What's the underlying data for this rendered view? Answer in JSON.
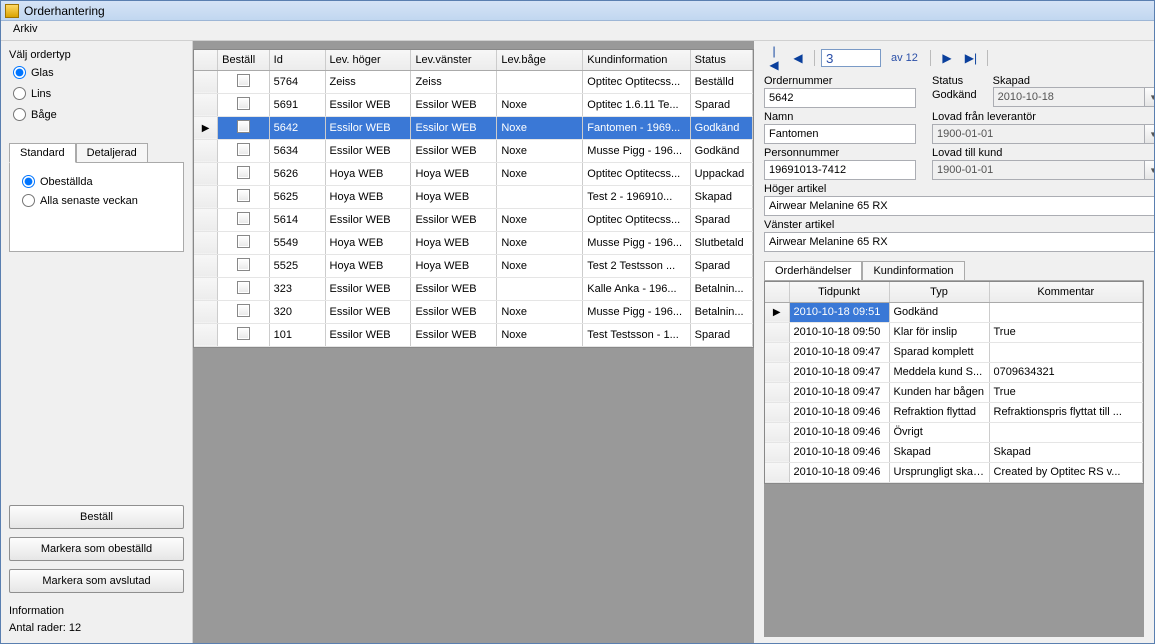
{
  "title": "Orderhantering",
  "menu": {
    "arkiv": "Arkiv"
  },
  "left": {
    "ordertype_label": "Välj ordertyp",
    "glas": "Glas",
    "lins": "Lins",
    "bage": "Båge",
    "tab_standard": "Standard",
    "tab_detaljerad": "Detaljerad",
    "opt_obestallda": "Obeställda",
    "opt_alla_veckan": "Alla senaste veckan",
    "btn_bestall": "Beställ",
    "btn_markera_obestalld": "Markera som obeställd",
    "btn_markera_avslutad": "Markera som avslutad",
    "info_label": "Information",
    "info_rows": "Antal rader: 12"
  },
  "grid": {
    "headers": {
      "bestall": "Beställ",
      "id": "Id",
      "lev_hoger": "Lev. höger",
      "lev_vanster": "Lev.vänster",
      "lev_bage": "Lev.båge",
      "kund": "Kundinformation",
      "status": "Status"
    },
    "rows": [
      {
        "id": "5764",
        "lh": "Zeiss",
        "lv": "Zeiss",
        "lb": "",
        "kund": "Optitec Optitecss...",
        "status": "Beställd",
        "sel": false
      },
      {
        "id": "5691",
        "lh": "Essilor WEB",
        "lv": "Essilor WEB",
        "lb": "Noxe",
        "kund": "Optitec 1.6.11 Te...",
        "status": "Sparad",
        "sel": false
      },
      {
        "id": "5642",
        "lh": "Essilor WEB",
        "lv": "Essilor WEB",
        "lb": "Noxe",
        "kund": "Fantomen  - 1969...",
        "status": "Godkänd",
        "sel": true
      },
      {
        "id": "5634",
        "lh": "Essilor WEB",
        "lv": "Essilor WEB",
        "lb": "Noxe",
        "kund": "Musse Pigg - 196...",
        "status": "Godkänd",
        "sel": false
      },
      {
        "id": "5626",
        "lh": "Hoya WEB",
        "lv": "Hoya WEB",
        "lb": "Noxe",
        "kund": "Optitec Optitecss...",
        "status": "Uppackad",
        "sel": false
      },
      {
        "id": "5625",
        "lh": "Hoya WEB",
        "lv": "Hoya WEB",
        "lb": "",
        "kund": "Test 2  - 196910...",
        "status": "Skapad",
        "sel": false
      },
      {
        "id": "5614",
        "lh": "Essilor WEB",
        "lv": "Essilor WEB",
        "lb": "Noxe",
        "kund": "Optitec Optitecss...",
        "status": "Sparad",
        "sel": false
      },
      {
        "id": "5549",
        "lh": "Hoya WEB",
        "lv": "Hoya WEB",
        "lb": "Noxe",
        "kund": "Musse Pigg - 196...",
        "status": "Slutbetald",
        "sel": false
      },
      {
        "id": "5525",
        "lh": "Hoya WEB",
        "lv": "Hoya WEB",
        "lb": "Noxe",
        "kund": "Test 2 Testsson ...",
        "status": "Sparad",
        "sel": false
      },
      {
        "id": "323",
        "lh": "Essilor WEB",
        "lv": "Essilor WEB",
        "lb": "",
        "kund": "Kalle Anka - 196...",
        "status": "Betalnin...",
        "sel": false
      },
      {
        "id": "320",
        "lh": "Essilor WEB",
        "lv": "Essilor WEB",
        "lb": "Noxe",
        "kund": "Musse Pigg - 196...",
        "status": "Betalnin...",
        "sel": false
      },
      {
        "id": "101",
        "lh": "Essilor WEB",
        "lv": "Essilor WEB",
        "lb": "Noxe",
        "kund": "Test Testsson - 1...",
        "status": "Sparad",
        "sel": false
      }
    ]
  },
  "nav": {
    "pos": "3",
    "of_label": "av 12"
  },
  "detail": {
    "ordernummer_label": "Ordernummer",
    "ordernummer": "5642",
    "status_label": "Status",
    "status": "Godkänd",
    "skapad_label": "Skapad",
    "skapad": "2010-10-18",
    "namn_label": "Namn",
    "namn": "Fantomen",
    "lovad_lev_label": "Lovad från leverantör",
    "lovad_lev": "1900-01-01",
    "personnr_label": "Personnummer",
    "personnr": "19691013-7412",
    "lovad_kund_label": "Lovad till kund",
    "lovad_kund": "1900-01-01",
    "hoger_artikel_label": "Höger artikel",
    "hoger_artikel": "Airwear Melanine 65 RX",
    "vanster_artikel_label": "Vänster artikel",
    "vanster_artikel": "Airwear Melanine 65 RX"
  },
  "subtabs": {
    "orderhandelser": "Orderhändelser",
    "kundinformation": "Kundinformation"
  },
  "events": {
    "headers": {
      "tid": "Tidpunkt",
      "typ": "Typ",
      "komm": "Kommentar"
    },
    "rows": [
      {
        "tid": "2010-10-18 09:51",
        "typ": "Godkänd",
        "komm": "",
        "sel": true
      },
      {
        "tid": "2010-10-18 09:50",
        "typ": "Klar för inslip",
        "komm": "True"
      },
      {
        "tid": "2010-10-18 09:47",
        "typ": "Sparad komplett",
        "komm": ""
      },
      {
        "tid": "2010-10-18 09:47",
        "typ": "Meddela kund S...",
        "komm": "0709634321"
      },
      {
        "tid": "2010-10-18 09:47",
        "typ": "Kunden har bågen",
        "komm": "True"
      },
      {
        "tid": "2010-10-18 09:46",
        "typ": "Refraktion flyttad",
        "komm": "Refraktionspris flyttat till ..."
      },
      {
        "tid": "2010-10-18 09:46",
        "typ": "Övrigt",
        "komm": ""
      },
      {
        "tid": "2010-10-18 09:46",
        "typ": "Skapad",
        "komm": "Skapad"
      },
      {
        "tid": "2010-10-18 09:46",
        "typ": "Ursprungligt skap...",
        "komm": "Created by Optitec RS v..."
      }
    ]
  }
}
